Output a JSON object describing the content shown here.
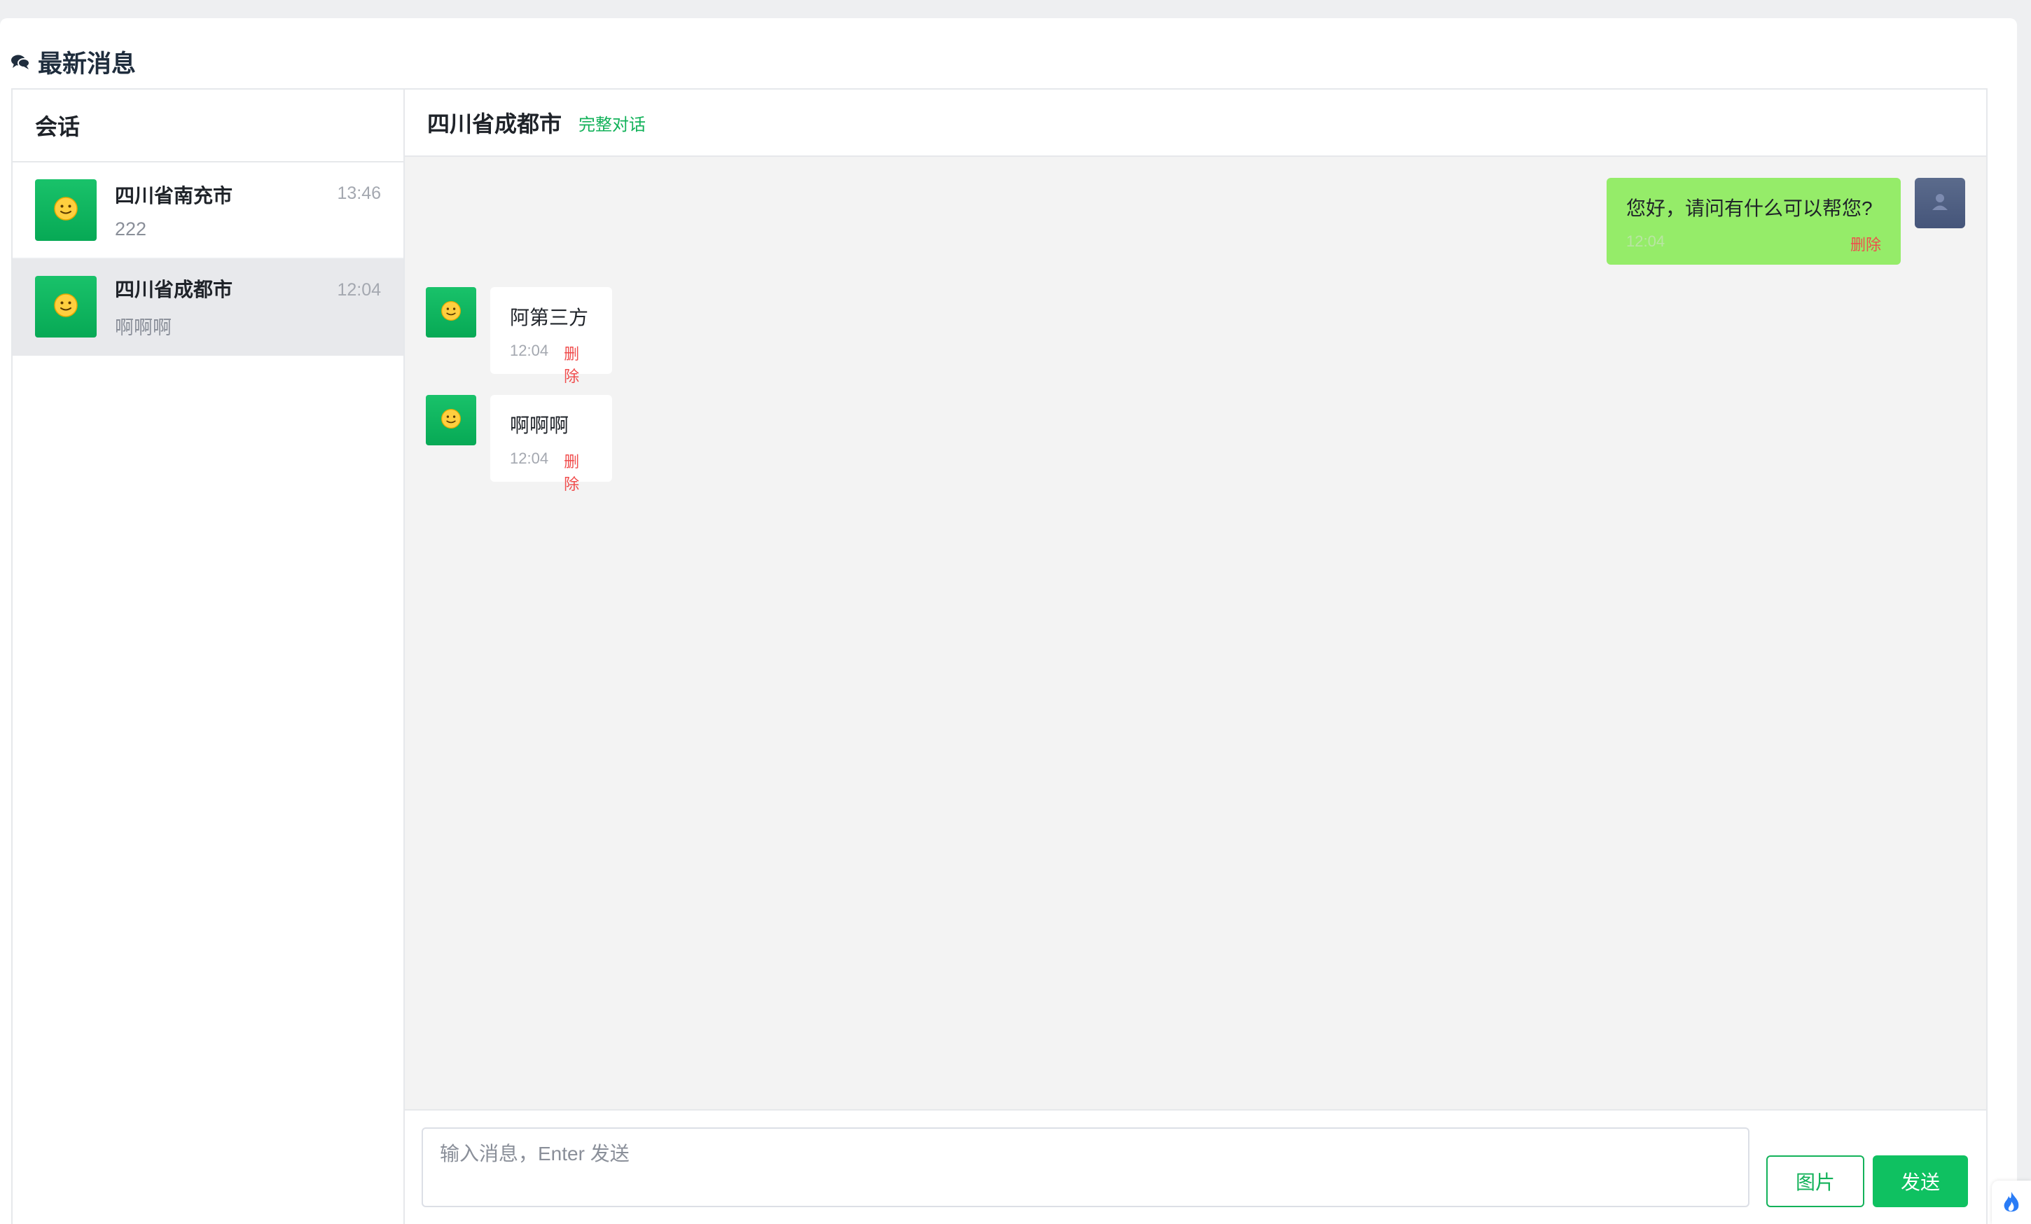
{
  "page": {
    "title": "最新消息",
    "title_icon": "comments-icon"
  },
  "conversations": {
    "header": "会话",
    "items": [
      {
        "name": "四川省南充市",
        "time": "13:46",
        "preview": "222",
        "avatar_icon": "smiley-icon",
        "active": false
      },
      {
        "name": "四川省成都市",
        "time": "12:04",
        "preview": "啊啊啊",
        "avatar_icon": "smiley-icon",
        "active": true
      }
    ]
  },
  "chat": {
    "title": "四川省成都市",
    "full_link": "完整对话",
    "messages": [
      {
        "from": "self",
        "text": "您好，请问有什么可以帮您?",
        "time": "12:04",
        "delete_label": "删除"
      },
      {
        "from": "customer",
        "text": "阿第三方",
        "time": "12:04",
        "delete_label": "删除"
      },
      {
        "from": "customer",
        "text": "啊啊啊",
        "time": "12:04",
        "delete_label": "删除"
      }
    ]
  },
  "composer": {
    "placeholder": "输入消息，Enter 发送",
    "image_button": "图片",
    "send_button": "发送"
  },
  "colors": {
    "accent": "#13b25a",
    "self_bubble": "#95ec69",
    "delete": "#f04c4c"
  }
}
